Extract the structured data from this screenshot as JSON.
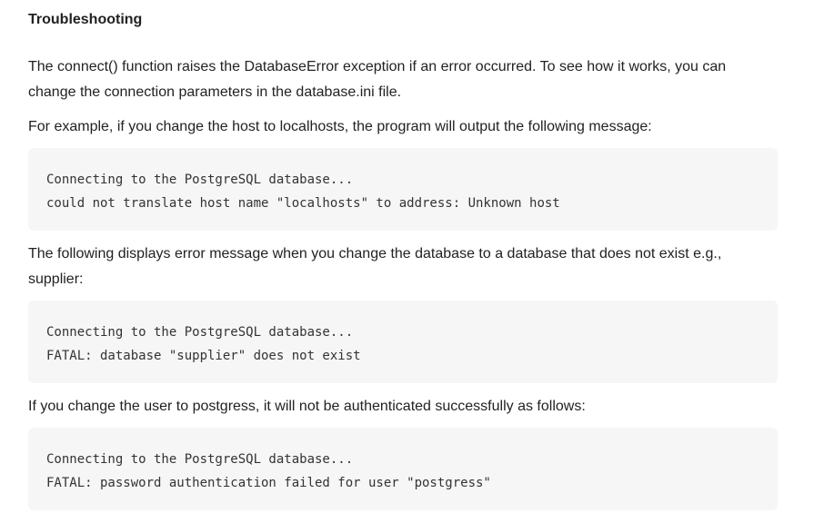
{
  "section": {
    "heading": "Troubleshooting"
  },
  "paragraphs": {
    "intro": "The connect() function raises the DatabaseError exception if an error occurred. To see how it works, you can change the connection parameters in the database.ini file.",
    "host_example": "For example, if you change the host to localhosts, the program will output the following message:",
    "database_example": "The following displays error message when you change the database to a database that does not exist e.g., supplier:",
    "user_example": "If you change the user to  postgress, it will not be authenticated successfully as follows:"
  },
  "code_blocks": [
    {
      "lines": [
        "Connecting to the PostgreSQL database...",
        "could not translate host name \"localhosts\" to address: Unknown host"
      ]
    },
    {
      "lines": [
        "Connecting to the PostgreSQL database...",
        "FATAL: database \"supplier\" does not exist"
      ]
    },
    {
      "lines": [
        "Connecting to the PostgreSQL database...",
        "FATAL: password authentication failed for user \"postgress\""
      ]
    }
  ]
}
